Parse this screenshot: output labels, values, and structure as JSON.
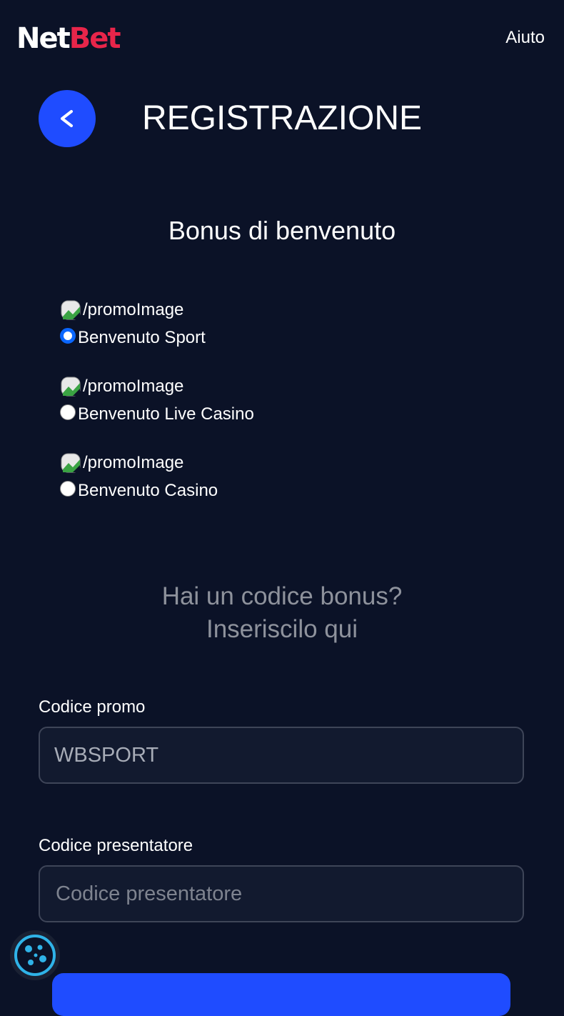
{
  "header": {
    "logo_net": "Net",
    "logo_bet": "Bet",
    "help_label": "Aiuto"
  },
  "page": {
    "title": "REGISTRAZIONE",
    "back_label": "<"
  },
  "welcome": {
    "title": "Bonus di benvenuto",
    "options": [
      {
        "image_alt": "/promoImage",
        "label": "Benvenuto Sport",
        "checked": true
      },
      {
        "image_alt": "/promoImage",
        "label": "Benvenuto Live Casino",
        "checked": false
      },
      {
        "image_alt": "/promoImage",
        "label": "Benvenuto Casino",
        "checked": false
      }
    ]
  },
  "bonus_code": {
    "line1": "Hai un codice bonus?",
    "line2": "Inseriscilo qui"
  },
  "form": {
    "promo_label": "Codice promo",
    "promo_value": "WBSPORT",
    "referrer_label": "Codice presentatore",
    "referrer_placeholder": "Codice presentatore"
  },
  "colors": {
    "background": "#0b1227",
    "accent": "#1f4cff",
    "brand_red": "#e8254a",
    "muted_text": "#8e929c"
  }
}
